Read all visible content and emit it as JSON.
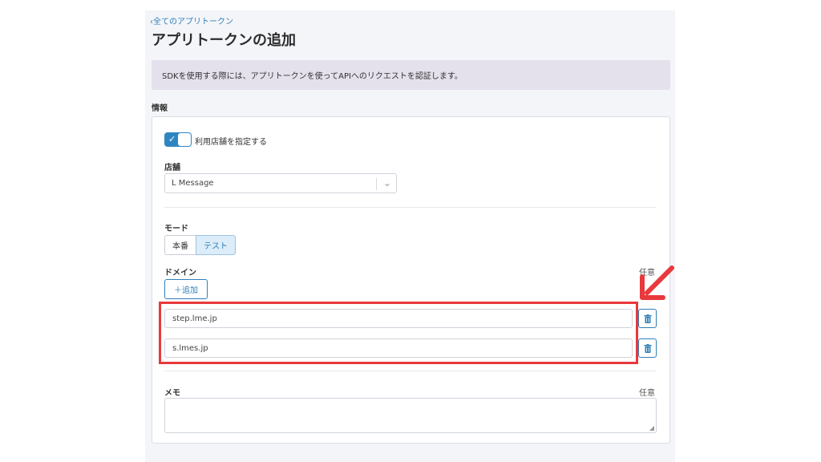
{
  "header": {
    "back_link": "‹全てのアプリトークン",
    "title": "アプリトークンの追加"
  },
  "info_banner": "SDKを使用する際には、アプリトークンを使ってAPIへのリクエストを認証します。",
  "section_label": "情報",
  "store_toggle": {
    "label": "利用店舗を指定する",
    "checked": true
  },
  "store": {
    "label": "店舗",
    "selected": "L Message"
  },
  "mode": {
    "label": "モード",
    "options": [
      "本番",
      "テスト"
    ],
    "selected": "テスト"
  },
  "domain": {
    "label": "ドメイン",
    "optional": "任意",
    "add_button": "＋追加",
    "entries": [
      "step.lme.jp",
      "s.lmes.jp"
    ]
  },
  "memo": {
    "label": "メモ",
    "optional": "任意",
    "value": ""
  },
  "icons": {
    "back": "chevron-left-icon",
    "select": "chevron-down-icon",
    "delete": "trash-icon",
    "annotation": "red-arrow-icon"
  },
  "colors": {
    "accent": "#2f7fb8",
    "banner": "#e4e0ec",
    "annotation": "#e8393c"
  }
}
